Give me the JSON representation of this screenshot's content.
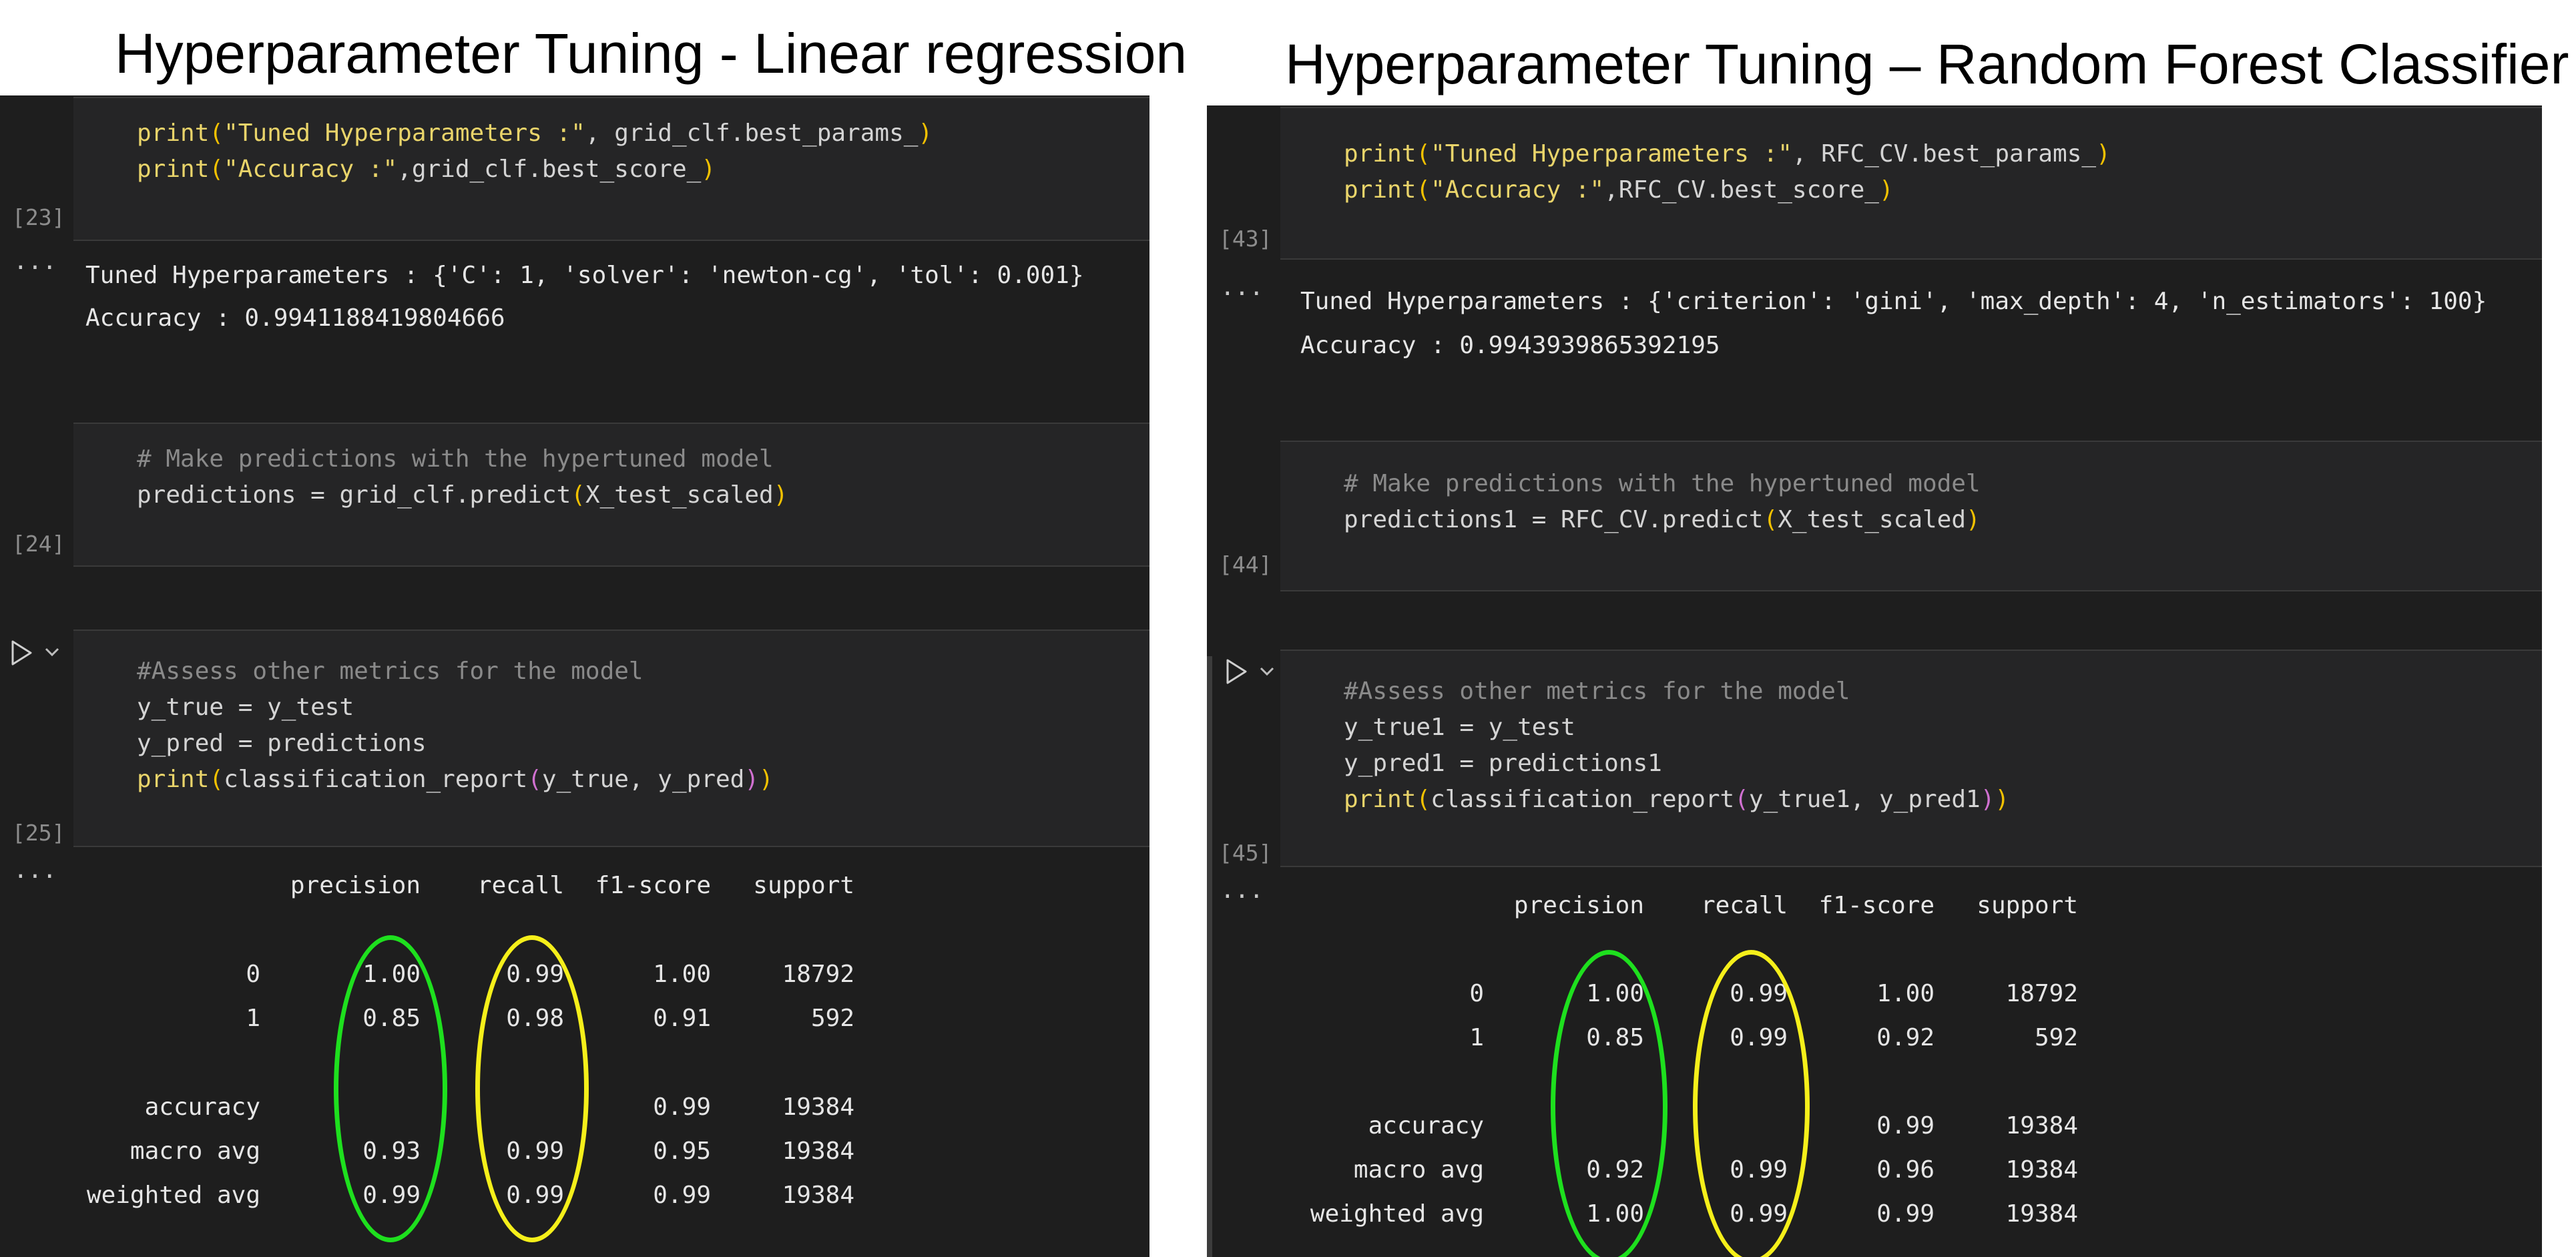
{
  "left": {
    "title": "Hyperparameter Tuning - Linear regression",
    "cell23": {
      "count": "[23]",
      "line1": {
        "fn": "print",
        "p1": "(",
        "s": "\"Tuned Hyperparameters :\"",
        "rest": ", grid_clf.best_params_",
        "p2": ")"
      },
      "line2": {
        "fn": "print",
        "p1": "(",
        "s": "\"Accuracy :\"",
        "rest": ",grid_clf.best_score_",
        "p2": ")"
      }
    },
    "out23": {
      "ellipsis": "···",
      "line1": "Tuned Hyperparameters : {'C': 1, 'solver': 'newton-cg', 'tol': 0.001}",
      "line2": "Accuracy : 0.9941188419804666"
    },
    "cell24": {
      "count": "[24]",
      "comment": "# Make predictions with the hypertuned model",
      "line2": {
        "a": "predictions ",
        "op": "=",
        "b": " grid_clf.predict",
        "p1": "(",
        "arg": "X_test_scaled",
        "p2": ")"
      }
    },
    "cell25": {
      "count": "[25]",
      "comment": "#Assess other metrics for the model",
      "l2": {
        "a": "y_true ",
        "op": "=",
        "b": " y_test"
      },
      "l3": {
        "a": "y_pred ",
        "op": "=",
        "b": " predictions"
      },
      "l4": {
        "fn": "print",
        "p1": "(",
        "mid": "classification_report",
        "p2": "(",
        "args": "y_true, y_pred",
        "p3": ")",
        "p4": ")"
      }
    },
    "report": {
      "ellipsis": "···",
      "headers": [
        "precision",
        "recall",
        "f1-score",
        "support"
      ],
      "rows": [
        {
          "label": "0",
          "precision": "1.00",
          "recall": "0.99",
          "f1": "1.00",
          "support": "18792"
        },
        {
          "label": "1",
          "precision": "0.85",
          "recall": "0.98",
          "f1": "0.91",
          "support": "592"
        },
        {
          "label": "accuracy",
          "precision": "",
          "recall": "",
          "f1": "0.99",
          "support": "19384"
        },
        {
          "label": "macro avg",
          "precision": "0.93",
          "recall": "0.99",
          "f1": "0.95",
          "support": "19384"
        },
        {
          "label": "weighted avg",
          "precision": "0.99",
          "recall": "0.99",
          "f1": "0.99",
          "support": "19384"
        }
      ]
    }
  },
  "right": {
    "title": "Hyperparameter Tuning – Random Forest Classifier",
    "cell43": {
      "count": "[43]",
      "line1": {
        "fn": "print",
        "p1": "(",
        "s": "\"Tuned Hyperparameters :\"",
        "rest": ", RFC_CV.best_params_",
        "p2": ")"
      },
      "line2": {
        "fn": "print",
        "p1": "(",
        "s": "\"Accuracy :\"",
        "rest": ",RFC_CV.best_score_",
        "p2": ")"
      }
    },
    "out43": {
      "ellipsis": "···",
      "line1": "Tuned Hyperparameters : {'criterion': 'gini', 'max_depth': 4, 'n_estimators': 100}",
      "line2": "Accuracy : 0.9943939865392195"
    },
    "cell44": {
      "count": "[44]",
      "comment": "# Make predictions with the hypertuned model",
      "line2": {
        "a": "predictions1 ",
        "op": "=",
        "b": " RFC_CV.predict",
        "p1": "(",
        "arg": "X_test_scaled",
        "p2": ")"
      }
    },
    "cell45": {
      "count": "[45]",
      "comment": "#Assess other metrics for the model",
      "l2": {
        "a": "y_true1 ",
        "op": "=",
        "b": " y_test"
      },
      "l3": {
        "a": "y_pred1 ",
        "op": "=",
        "b": " predictions1"
      },
      "l4": {
        "fn": "print",
        "p1": "(",
        "mid": "classification_report",
        "p2": "(",
        "args": "y_true1, y_pred1",
        "p3": ")",
        "p4": ")"
      }
    },
    "report": {
      "ellipsis": "···",
      "headers": [
        "precision",
        "recall",
        "f1-score",
        "support"
      ],
      "rows": [
        {
          "label": "0",
          "precision": "1.00",
          "recall": "0.99",
          "f1": "1.00",
          "support": "18792"
        },
        {
          "label": "1",
          "precision": "0.85",
          "recall": "0.99",
          "f1": "0.92",
          "support": "592"
        },
        {
          "label": "accuracy",
          "precision": "",
          "recall": "",
          "f1": "0.99",
          "support": "19384"
        },
        {
          "label": "macro avg",
          "precision": "0.92",
          "recall": "0.99",
          "f1": "0.96",
          "support": "19384"
        },
        {
          "label": "weighted avg",
          "precision": "1.00",
          "recall": "0.99",
          "f1": "0.99",
          "support": "19384"
        }
      ]
    }
  },
  "colors": {
    "precision_circle": "#1ee01e",
    "recall_circle": "#f5ef1a"
  }
}
